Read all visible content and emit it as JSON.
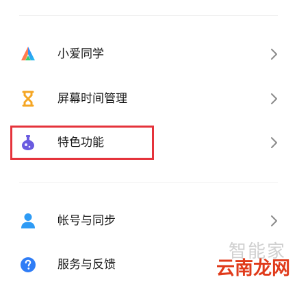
{
  "menu": {
    "items": [
      {
        "label": "小爱同学",
        "icon": "xiaoai-assistant-icon"
      },
      {
        "label": "屏幕时间管理",
        "icon": "hourglass-icon"
      },
      {
        "label": "特色功能",
        "icon": "flask-icon"
      },
      {
        "label": "帐号与同步",
        "icon": "account-person-icon"
      },
      {
        "label": "服务与反馈",
        "icon": "help-question-icon"
      }
    ],
    "highlighted_item": "特色功能"
  },
  "colors": {
    "highlight_border": "#e5333b",
    "hourglass": "#f5a623",
    "flask": "#6a5be0",
    "account": "#2e9bf5",
    "help": "#2f7df6",
    "watermark_red": "#e03a1a"
  },
  "watermark": {
    "top_text": "智能家",
    "bottom_text": "云南龙网"
  }
}
